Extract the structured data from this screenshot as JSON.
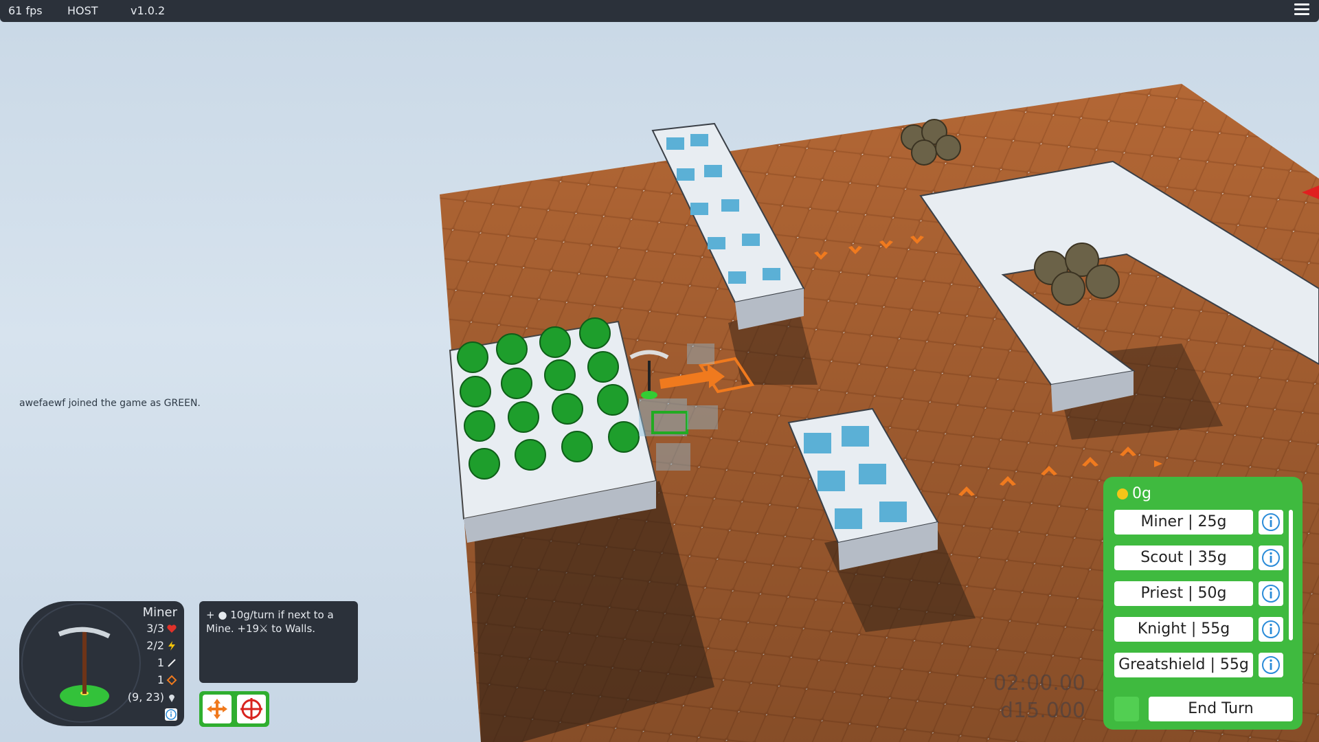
{
  "topbar": {
    "fps": "61 fps",
    "role": "HOST",
    "version": "v1.0.2",
    "menu_icon": "hamburger-menu-icon"
  },
  "chat": {
    "message": "awefaewf joined the game as GREEN."
  },
  "unit": {
    "name": "Miner",
    "health": "3/3",
    "energy": "2/2",
    "attack": "1",
    "defense": "1",
    "position": "(9, 23)",
    "icon": "pickaxe-icon"
  },
  "description": {
    "text": "+ ● 10g/turn if next to a Mine. +19⚔ to Walls."
  },
  "actions": {
    "move_icon": "move-arrows-icon",
    "attack_icon": "crosshair-target-icon"
  },
  "timers": {
    "clock": "02:00.00",
    "delay": "d15.000"
  },
  "shop": {
    "gold": "0g",
    "items": [
      {
        "label": "Miner | 25g"
      },
      {
        "label": "Scout | 35g"
      },
      {
        "label": "Priest | 50g"
      },
      {
        "label": "Knight | 55g"
      },
      {
        "label": "Greatshield | 55g"
      }
    ],
    "end_turn": "End Turn"
  },
  "colors": {
    "player": "#3fba3f",
    "panel": "#2b313a",
    "gold": "#f5c518",
    "highlight": "#f07a1e"
  }
}
